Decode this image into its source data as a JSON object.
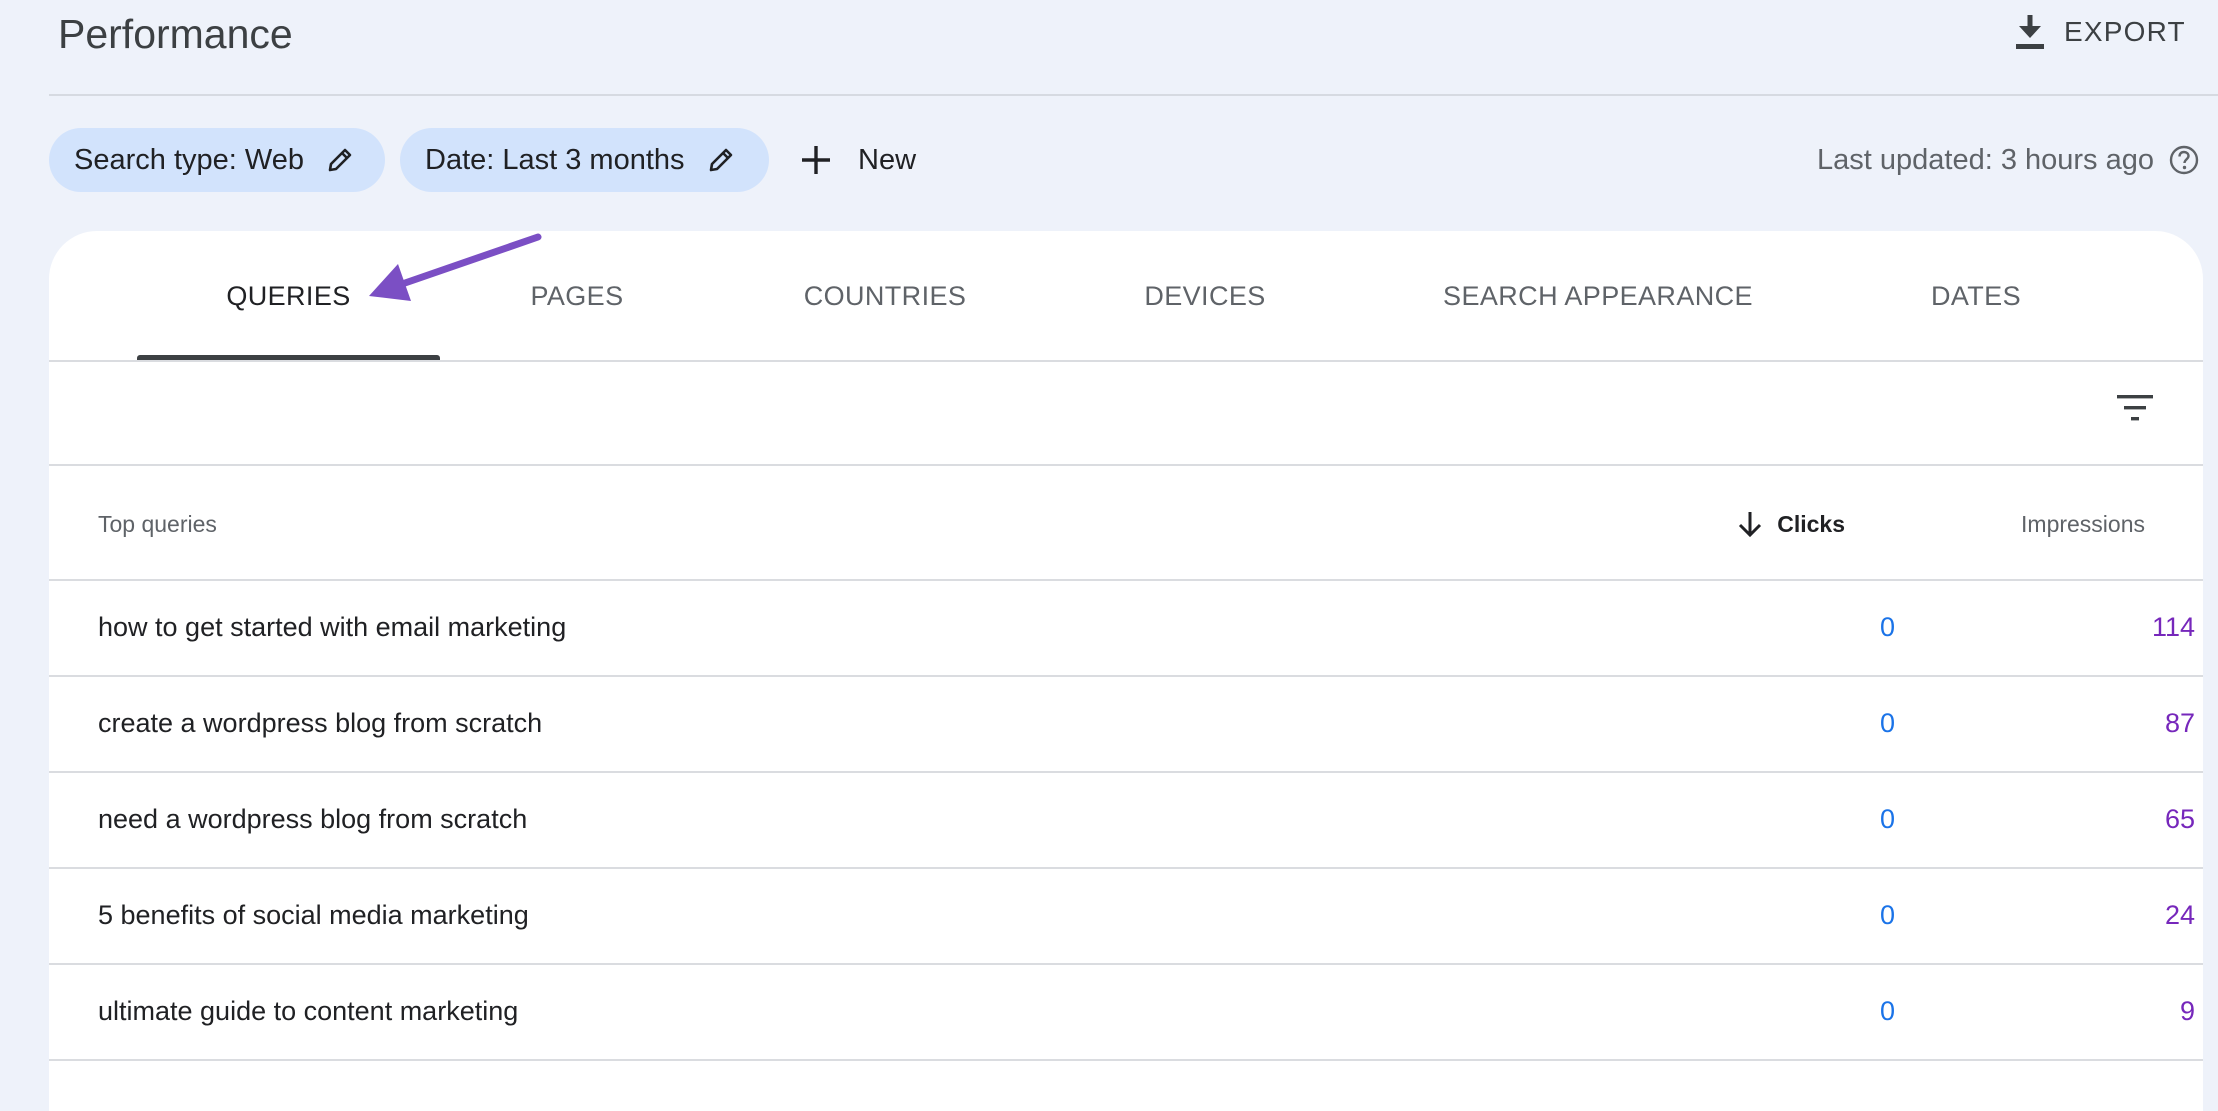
{
  "header": {
    "title": "Performance",
    "export_label": "EXPORT"
  },
  "filters": {
    "search_type": "Search type: Web",
    "date": "Date: Last 3 months",
    "new_label": "New",
    "last_updated": "Last updated: 3 hours ago"
  },
  "tabs": [
    {
      "label": "QUERIES",
      "active": true
    },
    {
      "label": "PAGES",
      "active": false
    },
    {
      "label": "COUNTRIES",
      "active": false
    },
    {
      "label": "DEVICES",
      "active": false
    },
    {
      "label": "SEARCH APPEARANCE",
      "active": false
    },
    {
      "label": "DATES",
      "active": false
    }
  ],
  "table": {
    "headers": {
      "query": "Top queries",
      "clicks": "Clicks",
      "impressions": "Impressions"
    },
    "sorted_by": "Clicks",
    "rows": [
      {
        "query": "how to get started with email marketing",
        "clicks": "0",
        "impressions": "114"
      },
      {
        "query": "create a wordpress blog from scratch",
        "clicks": "0",
        "impressions": "87"
      },
      {
        "query": "need a wordpress blog from scratch",
        "clicks": "0",
        "impressions": "65"
      },
      {
        "query": "5 benefits of social media marketing",
        "clicks": "0",
        "impressions": "24"
      },
      {
        "query": "ultimate guide to content marketing",
        "clicks": "0",
        "impressions": "9"
      }
    ]
  },
  "colors": {
    "background": "#eef2fa",
    "chip": "#d2e3fc",
    "clicks": "#1a73e8",
    "impressions": "#7627bb",
    "annotation_arrow": "#7b4fc4"
  },
  "icons": {
    "export": "download-icon",
    "edit": "pencil-icon",
    "new": "plus-icon",
    "help": "help-circle-icon",
    "filter": "filter-list-icon",
    "sort": "arrow-down-icon"
  }
}
